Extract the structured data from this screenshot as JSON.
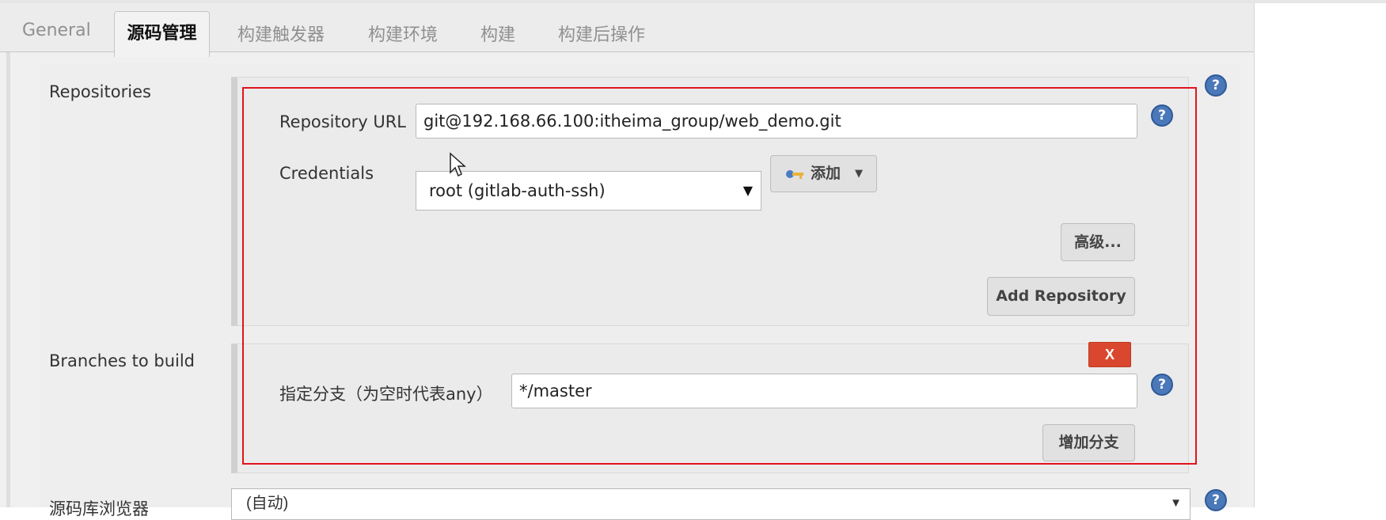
{
  "tabs": [
    {
      "label": "General",
      "active": false
    },
    {
      "label": "源码管理",
      "active": true
    },
    {
      "label": "构建触发器",
      "active": false
    },
    {
      "label": "构建环境",
      "active": false
    },
    {
      "label": "构建",
      "active": false
    },
    {
      "label": "构建后操作",
      "active": false
    }
  ],
  "repositories": {
    "section_label": "Repositories",
    "url_label": "Repository URL",
    "url_value": "git@192.168.66.100:itheima_group/web_demo.git",
    "credentials_label": "Credentials",
    "credentials_selected": "root (gitlab-auth-ssh)",
    "add_button_label": "添加",
    "advanced_button_label": "高级...",
    "add_repository_label": "Add Repository"
  },
  "branches": {
    "section_label": "Branches to build",
    "branch_label": "指定分支（为空时代表any）",
    "branch_value": "*/master",
    "delete_label": "X",
    "add_branch_label": "增加分支"
  },
  "browser": {
    "section_label": "源码库浏览器",
    "selected": "(自动)"
  },
  "help_glyph": "?",
  "colors": {
    "highlight_border": "#e0141c",
    "delete_button": "#d9482e",
    "help_icon": "#4b78b8"
  }
}
